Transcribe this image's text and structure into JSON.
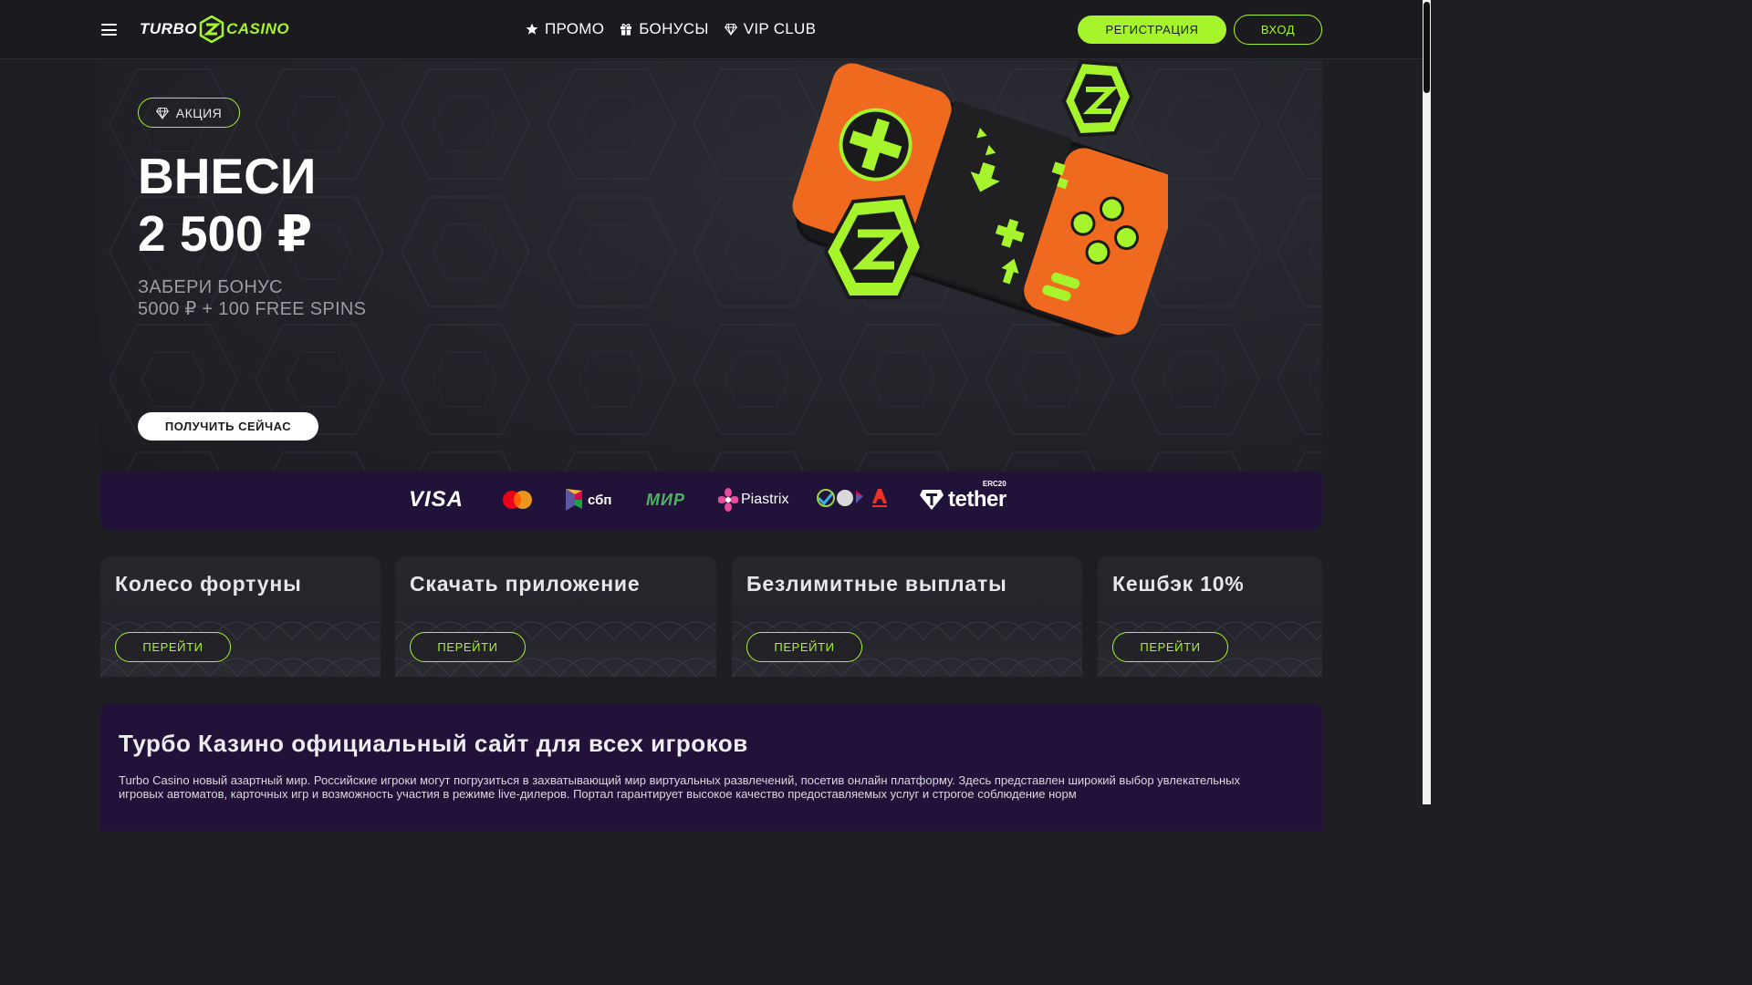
{
  "header": {
    "logo_left": "TURBO",
    "logo_right": "CASINO",
    "nav": [
      {
        "label": "ПРОМО",
        "icon": "star-icon"
      },
      {
        "label": "БОНУСЫ",
        "icon": "gift-icon"
      },
      {
        "label": "VIP CLUB",
        "icon": "diamond-icon"
      }
    ],
    "register_label": "РЕГИСТРАЦИЯ",
    "login_label": "ВХОД"
  },
  "hero": {
    "badge": "АКЦИЯ",
    "title_line1": "ВНЕСИ",
    "title_line2": "2 500 ₽",
    "sub_line1": "ЗАБЕРИ БОНУС",
    "sub_line2": "5000 ₽ + 100 FREE SPINS",
    "cta": "ПОЛУЧИТЬ СЕЙЧАС"
  },
  "payments": {
    "visa": "VISA",
    "sbp": "сбп",
    "mir": "МИР",
    "piastrix": "Piastrix",
    "skypay": "SKY PAY",
    "tether": "tether",
    "tether_badge": "ERC20"
  },
  "cards": [
    {
      "title": "Колесо фортуны",
      "button": "ПЕРЕЙТИ"
    },
    {
      "title": "Скачать приложение",
      "button": "ПЕРЕЙТИ"
    },
    {
      "title": "Безлимитные выплаты",
      "button": "ПЕРЕЙТИ"
    },
    {
      "title": "Кешбэк 10%",
      "button": "ПЕРЕЙТИ"
    }
  ],
  "seo": {
    "title": "Турбо Казино официальный сайт для всех игроков",
    "text": "Turbo Casino  новый азартный мир. Российские игроки могут погрузиться в захватывающий мир виртуальных развлечений, посетив онлайн платформу. Здесь представлен широкий выбор увлекательных игровых автоматов, карточных игр и возможность участия в режиме live-дилеров. Портал гарантирует высокое качество предоставляемых услуг и строгое соблюдение норм"
  },
  "colors": {
    "accent": "#a6f42c",
    "orange": "#ef6a1f",
    "header_bg": "#1b1b1f",
    "payments_bg": "#21123a"
  }
}
